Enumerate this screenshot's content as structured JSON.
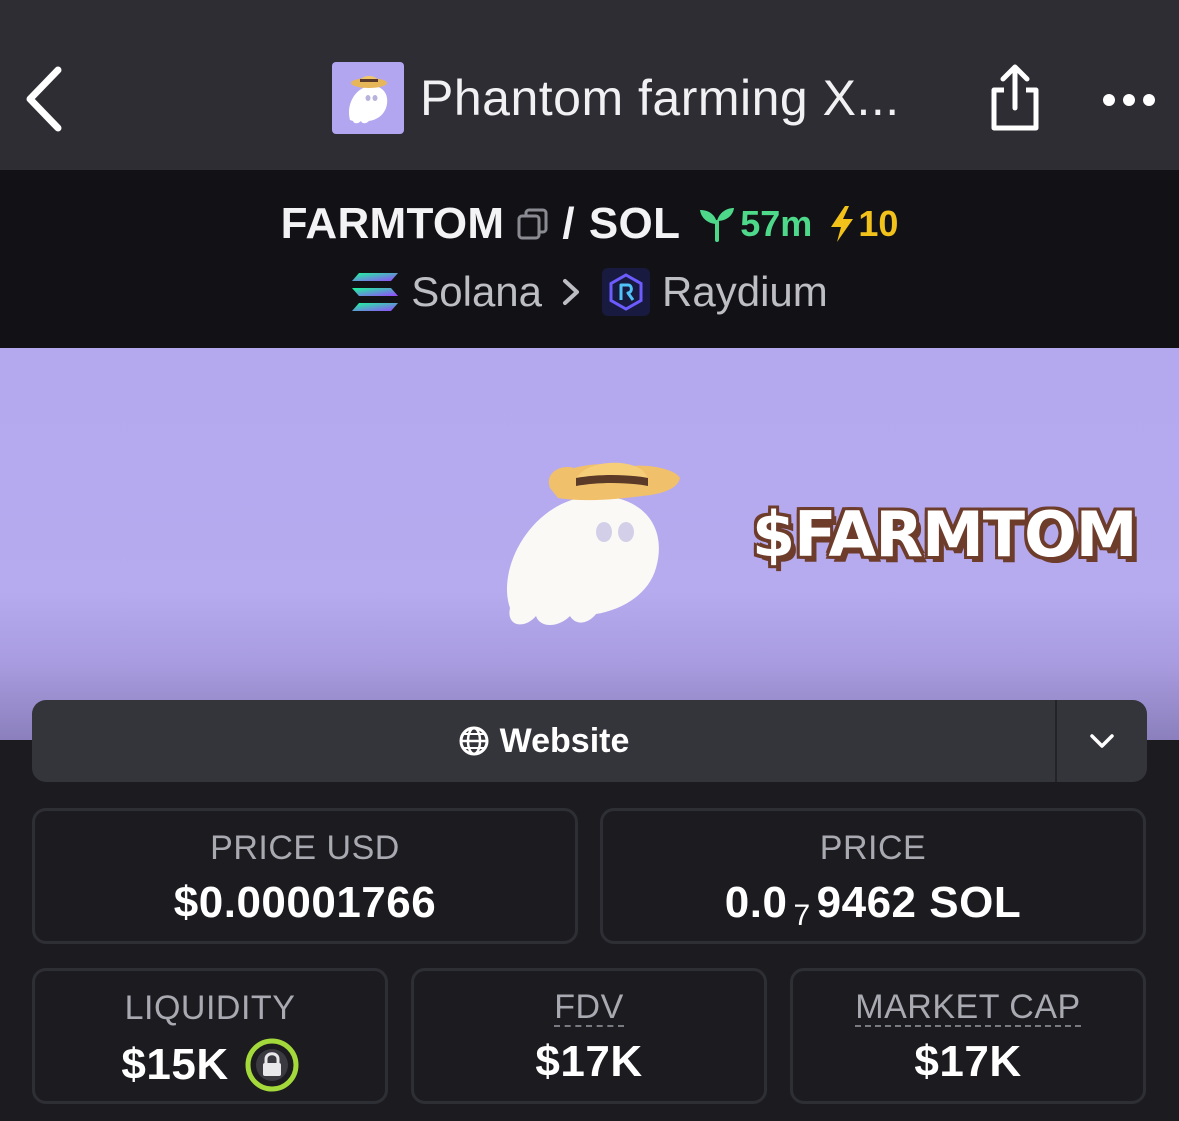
{
  "header": {
    "title": "Phantom farming X...",
    "back_icon": "chevron-left-icon",
    "share_icon": "share-icon",
    "more_icon": "ellipsis-icon"
  },
  "pair": {
    "base": "FARMTOM",
    "separator": "/",
    "quote": "SOL",
    "age": "57m",
    "boosts": "10",
    "age_color": "#4ed88a",
    "boost_color": "#f2c21b"
  },
  "breadcrumb": {
    "chain": "Solana",
    "dex": "Raydium"
  },
  "banner": {
    "ticker_text": "$FARMTOM",
    "bg_color": "#b4a8ef"
  },
  "links": {
    "website_label": "Website"
  },
  "stats": {
    "price_usd": {
      "label": "PRICE USD",
      "value": "$0.00001766"
    },
    "price_native": {
      "label": "PRICE",
      "prefix": "0.0",
      "zeros": "7",
      "digits": "9462",
      "unit": "SOL"
    },
    "liquidity": {
      "label": "LIQUIDITY",
      "value": "$15K",
      "locked": true
    },
    "fdv": {
      "label": "FDV",
      "value": "$17K"
    },
    "market_cap": {
      "label": "MARKET CAP",
      "value": "$17K"
    }
  }
}
